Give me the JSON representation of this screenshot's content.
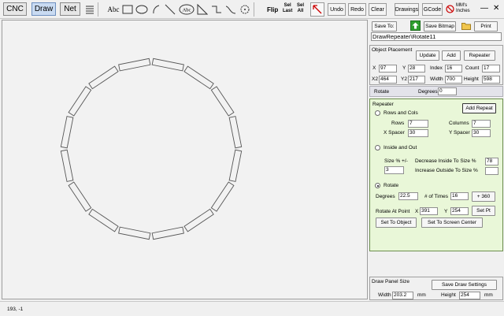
{
  "toolbar": {
    "tabs": [
      "CNC",
      "Draw",
      "Net"
    ],
    "abc_label": "Abc",
    "abc2_label": "Abc",
    "flip": "Flip",
    "sel_last": [
      "Sel",
      "Last"
    ],
    "sel_all": [
      "Sel",
      "All"
    ],
    "undo": "Undo",
    "redo": "Redo",
    "clear": "Clear",
    "drawings": "Drawings",
    "gcode": "GCode",
    "units": [
      "MM's",
      "Inches"
    ]
  },
  "panel": {
    "save_to": "Save To:",
    "save_bitmap": "Save Bitmap",
    "print": "Print",
    "drawing_name": "DrawRepeater\\Rotate11",
    "object_placement": "Object Placement",
    "update": "Update",
    "add": "Add",
    "repeater": "Repeater",
    "x_label": "X",
    "x_val": "97",
    "y_label": "Y",
    "y_val": "28",
    "index_label": "Index",
    "index_val": "16",
    "count_label": "Count",
    "count_val": "17",
    "x2_label": "X2",
    "x2_val": "464",
    "y2_label": "Y2",
    "y2_val": "217",
    "width_label": "Width",
    "width_val": "700",
    "height_label": "Height",
    "height_val": "598",
    "rotate_label": "Rotate",
    "degrees_label": "Degrees",
    "degrees_val": "0"
  },
  "repeater_panel": {
    "title": "Repeater",
    "add_repeat": "Add Repeat",
    "rows_and_cols": "Rows and Cols",
    "rows_label": "Rows",
    "rows_val": "7",
    "columns_label": "Columns",
    "columns_val": "7",
    "x_spacer_label": "X Spacer",
    "x_spacer_val": "30",
    "y_spacer_label": "Y Spacer",
    "y_spacer_val": "30",
    "inside_and_out": "Inside and Out",
    "size_label": "Size % +/-",
    "size_val": "3",
    "decrease_label": "Decrease Inside To Size %",
    "decrease_val": "78",
    "increase_label": "Increase Outside To Size %",
    "increase_val": "",
    "rotate": "Rotate",
    "deg_label": "Degrees",
    "deg_val": "22.5",
    "times_label": "# of Times",
    "times_val": "16",
    "plus360": "+ 360",
    "rotate_at_label": "Rotate At Point",
    "rx_label": "X",
    "rx_val": "391",
    "ry_label": "Y",
    "ry_val": "254",
    "set_pt": "Set Pt",
    "set_to_object": "Set To Object",
    "set_to_center": "Set To Screen Center"
  },
  "draw_panel": {
    "title": "Draw Panel Size",
    "save_settings": "Save Draw Settings",
    "width_label": "Width",
    "width_val": "203.2",
    "width_unit": "mm",
    "height_label": "Height",
    "height_val": "254",
    "height_unit": "mm"
  },
  "status": {
    "coords": "193, -1"
  },
  "window": {
    "minimize": "—",
    "close": "✕"
  },
  "drawing": {
    "segment_count": 16,
    "ring_center": [
      191,
      188
    ],
    "ring_radius": 110
  }
}
